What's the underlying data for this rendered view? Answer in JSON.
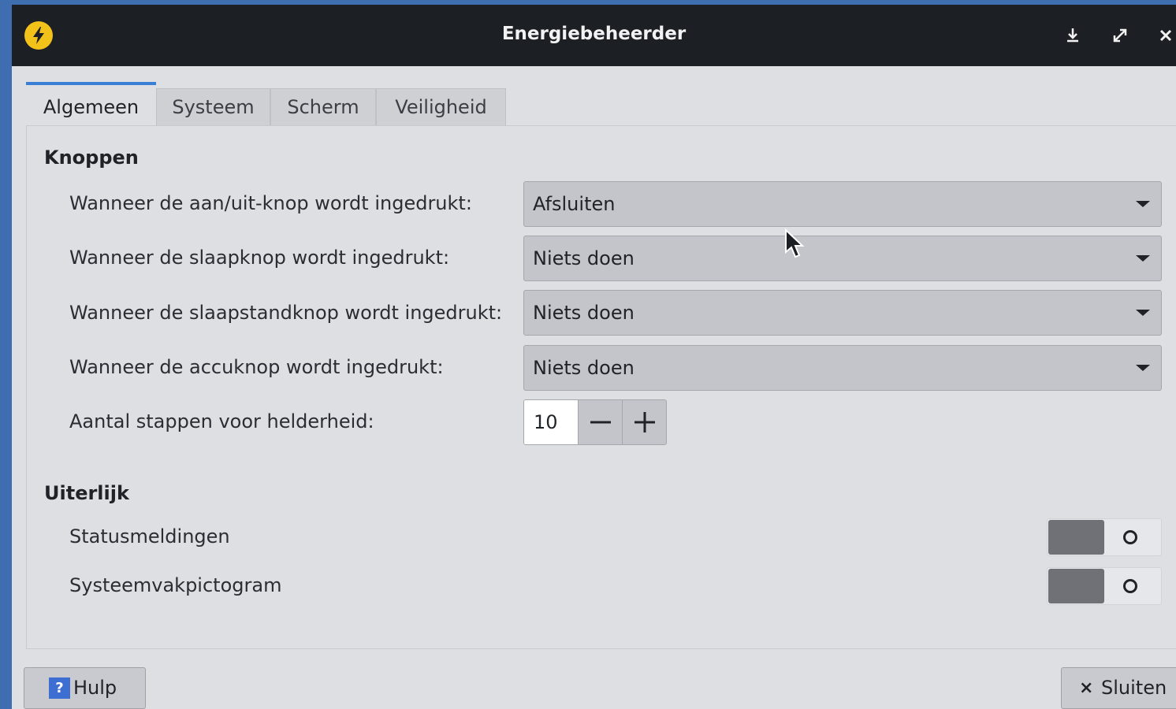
{
  "window": {
    "title": "Energiebeheerder",
    "icon": "lightning-bolt-icon",
    "controls": [
      "minimize-icon",
      "maximize-icon",
      "close-icon"
    ]
  },
  "tabs": [
    {
      "label": "Algemeen",
      "active": true
    },
    {
      "label": "Systeem",
      "active": false
    },
    {
      "label": "Scherm",
      "active": false
    },
    {
      "label": "Veiligheid",
      "active": false
    }
  ],
  "buttons_section": {
    "heading": "Knoppen",
    "rows": [
      {
        "label": "Wanneer de aan/uit-knop wordt ingedrukt:",
        "value": "Afsluiten"
      },
      {
        "label": "Wanneer de slaapknop wordt ingedrukt:",
        "value": "Niets doen"
      },
      {
        "label": "Wanneer de slaapstandknop wordt ingedrukt:",
        "value": "Niets doen"
      },
      {
        "label": "Wanneer de accuknop wordt ingedrukt:",
        "value": "Niets doen"
      }
    ],
    "brightness": {
      "label": "Aantal stappen voor helderheid:",
      "value": "10"
    }
  },
  "appearance_section": {
    "heading": "Uiterlijk",
    "toggles": [
      {
        "label": "Statusmeldingen",
        "enabled": false
      },
      {
        "label": "Systeemvakpictogram",
        "enabled": false
      }
    ]
  },
  "footer": {
    "help_label": "Hulp",
    "help_icon_glyph": "?",
    "close_label": "Sluiten",
    "close_icon_glyph": "×"
  },
  "colors": {
    "titlebar": "#1c1f24",
    "accent": "#3a7fd6",
    "app_icon": "#f2c21b",
    "help_icon": "#3c6fd1"
  }
}
